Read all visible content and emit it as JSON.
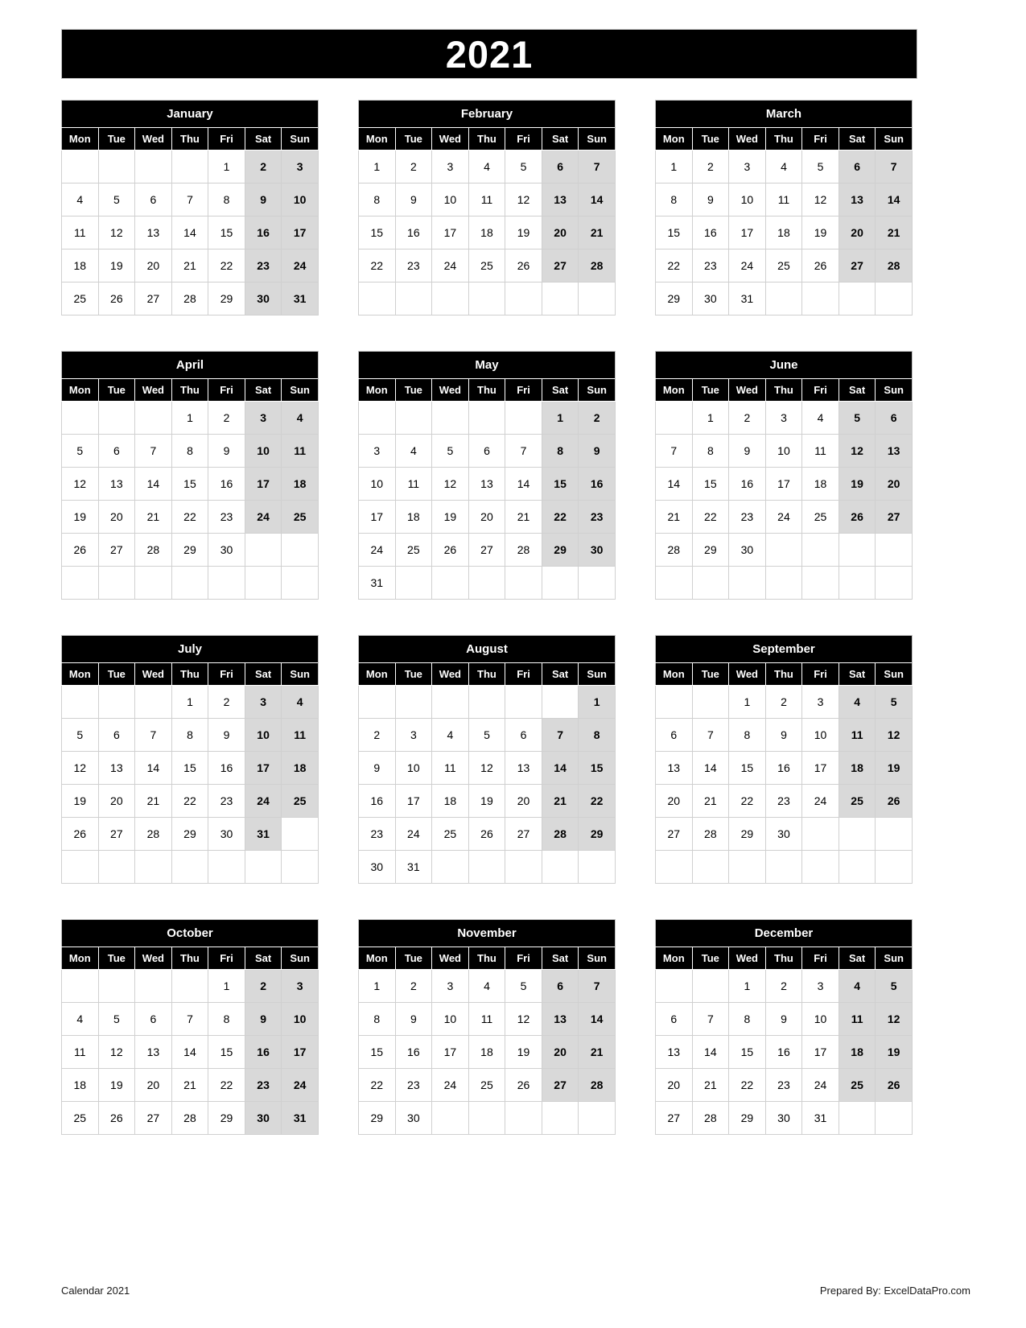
{
  "title": {
    "year": "2021"
  },
  "colors": {
    "header_bg": "#000000",
    "header_text": "#ffffff",
    "weekend_bg": "#d9d9d9",
    "cell_bg": "#ffffff",
    "grid_line": "#d0d0d0",
    "page_bg": "#ffffff"
  },
  "weekday_headers": [
    "Mon",
    "Tue",
    "Wed",
    "Thu",
    "Fri",
    "Sat",
    "Sun"
  ],
  "footer": {
    "left": "Calendar 2021",
    "right": "Prepared By: ExcelDataPro.com"
  },
  "months": [
    {
      "name": "January",
      "weeks": [
        [
          "",
          "",
          "",
          "",
          "1",
          "2",
          "3"
        ],
        [
          "4",
          "5",
          "6",
          "7",
          "8",
          "9",
          "10"
        ],
        [
          "11",
          "12",
          "13",
          "14",
          "15",
          "16",
          "17"
        ],
        [
          "18",
          "19",
          "20",
          "21",
          "22",
          "23",
          "24"
        ],
        [
          "25",
          "26",
          "27",
          "28",
          "29",
          "30",
          "31"
        ]
      ]
    },
    {
      "name": "February",
      "weeks": [
        [
          "1",
          "2",
          "3",
          "4",
          "5",
          "6",
          "7"
        ],
        [
          "8",
          "9",
          "10",
          "11",
          "12",
          "13",
          "14"
        ],
        [
          "15",
          "16",
          "17",
          "18",
          "19",
          "20",
          "21"
        ],
        [
          "22",
          "23",
          "24",
          "25",
          "26",
          "27",
          "28"
        ],
        [
          "",
          "",
          "",
          "",
          "",
          "",
          ""
        ]
      ]
    },
    {
      "name": "March",
      "weeks": [
        [
          "1",
          "2",
          "3",
          "4",
          "5",
          "6",
          "7"
        ],
        [
          "8",
          "9",
          "10",
          "11",
          "12",
          "13",
          "14"
        ],
        [
          "15",
          "16",
          "17",
          "18",
          "19",
          "20",
          "21"
        ],
        [
          "22",
          "23",
          "24",
          "25",
          "26",
          "27",
          "28"
        ],
        [
          "29",
          "30",
          "31",
          "",
          "",
          "",
          ""
        ]
      ]
    },
    {
      "name": "April",
      "weeks": [
        [
          "",
          "",
          "",
          "1",
          "2",
          "3",
          "4"
        ],
        [
          "5",
          "6",
          "7",
          "8",
          "9",
          "10",
          "11"
        ],
        [
          "12",
          "13",
          "14",
          "15",
          "16",
          "17",
          "18"
        ],
        [
          "19",
          "20",
          "21",
          "22",
          "23",
          "24",
          "25"
        ],
        [
          "26",
          "27",
          "28",
          "29",
          "30",
          "",
          ""
        ],
        [
          "",
          "",
          "",
          "",
          "",
          "",
          ""
        ]
      ]
    },
    {
      "name": "May",
      "weeks": [
        [
          "",
          "",
          "",
          "",
          "",
          "1",
          "2"
        ],
        [
          "3",
          "4",
          "5",
          "6",
          "7",
          "8",
          "9"
        ],
        [
          "10",
          "11",
          "12",
          "13",
          "14",
          "15",
          "16"
        ],
        [
          "17",
          "18",
          "19",
          "20",
          "21",
          "22",
          "23"
        ],
        [
          "24",
          "25",
          "26",
          "27",
          "28",
          "29",
          "30"
        ],
        [
          "31",
          "",
          "",
          "",
          "",
          "",
          ""
        ]
      ]
    },
    {
      "name": "June",
      "weeks": [
        [
          "",
          "1",
          "2",
          "3",
          "4",
          "5",
          "6"
        ],
        [
          "7",
          "8",
          "9",
          "10",
          "11",
          "12",
          "13"
        ],
        [
          "14",
          "15",
          "16",
          "17",
          "18",
          "19",
          "20"
        ],
        [
          "21",
          "22",
          "23",
          "24",
          "25",
          "26",
          "27"
        ],
        [
          "28",
          "29",
          "30",
          "",
          "",
          "",
          ""
        ],
        [
          "",
          "",
          "",
          "",
          "",
          "",
          ""
        ]
      ]
    },
    {
      "name": "July",
      "weeks": [
        [
          "",
          "",
          "",
          "1",
          "2",
          "3",
          "4"
        ],
        [
          "5",
          "6",
          "7",
          "8",
          "9",
          "10",
          "11"
        ],
        [
          "12",
          "13",
          "14",
          "15",
          "16",
          "17",
          "18"
        ],
        [
          "19",
          "20",
          "21",
          "22",
          "23",
          "24",
          "25"
        ],
        [
          "26",
          "27",
          "28",
          "29",
          "30",
          "31",
          ""
        ],
        [
          "",
          "",
          "",
          "",
          "",
          "",
          ""
        ]
      ]
    },
    {
      "name": "August",
      "weeks": [
        [
          "",
          "",
          "",
          "",
          "",
          "",
          "1"
        ],
        [
          "2",
          "3",
          "4",
          "5",
          "6",
          "7",
          "8"
        ],
        [
          "9",
          "10",
          "11",
          "12",
          "13",
          "14",
          "15"
        ],
        [
          "16",
          "17",
          "18",
          "19",
          "20",
          "21",
          "22"
        ],
        [
          "23",
          "24",
          "25",
          "26",
          "27",
          "28",
          "29"
        ],
        [
          "30",
          "31",
          "",
          "",
          "",
          "",
          ""
        ]
      ]
    },
    {
      "name": "September",
      "weeks": [
        [
          "",
          "",
          "1",
          "2",
          "3",
          "4",
          "5"
        ],
        [
          "6",
          "7",
          "8",
          "9",
          "10",
          "11",
          "12"
        ],
        [
          "13",
          "14",
          "15",
          "16",
          "17",
          "18",
          "19"
        ],
        [
          "20",
          "21",
          "22",
          "23",
          "24",
          "25",
          "26"
        ],
        [
          "27",
          "28",
          "29",
          "30",
          "",
          "",
          ""
        ],
        [
          "",
          "",
          "",
          "",
          "",
          "",
          ""
        ]
      ]
    },
    {
      "name": "October",
      "weeks": [
        [
          "",
          "",
          "",
          "",
          "1",
          "2",
          "3"
        ],
        [
          "4",
          "5",
          "6",
          "7",
          "8",
          "9",
          "10"
        ],
        [
          "11",
          "12",
          "13",
          "14",
          "15",
          "16",
          "17"
        ],
        [
          "18",
          "19",
          "20",
          "21",
          "22",
          "23",
          "24"
        ],
        [
          "25",
          "26",
          "27",
          "28",
          "29",
          "30",
          "31"
        ]
      ]
    },
    {
      "name": "November",
      "weeks": [
        [
          "1",
          "2",
          "3",
          "4",
          "5",
          "6",
          "7"
        ],
        [
          "8",
          "9",
          "10",
          "11",
          "12",
          "13",
          "14"
        ],
        [
          "15",
          "16",
          "17",
          "18",
          "19",
          "20",
          "21"
        ],
        [
          "22",
          "23",
          "24",
          "25",
          "26",
          "27",
          "28"
        ],
        [
          "29",
          "30",
          "",
          "",
          "",
          "",
          ""
        ]
      ]
    },
    {
      "name": "December",
      "weeks": [
        [
          "",
          "",
          "1",
          "2",
          "3",
          "4",
          "5"
        ],
        [
          "6",
          "7",
          "8",
          "9",
          "10",
          "11",
          "12"
        ],
        [
          "13",
          "14",
          "15",
          "16",
          "17",
          "18",
          "19"
        ],
        [
          "20",
          "21",
          "22",
          "23",
          "24",
          "25",
          "26"
        ],
        [
          "27",
          "28",
          "29",
          "30",
          "31",
          "",
          ""
        ]
      ]
    }
  ]
}
